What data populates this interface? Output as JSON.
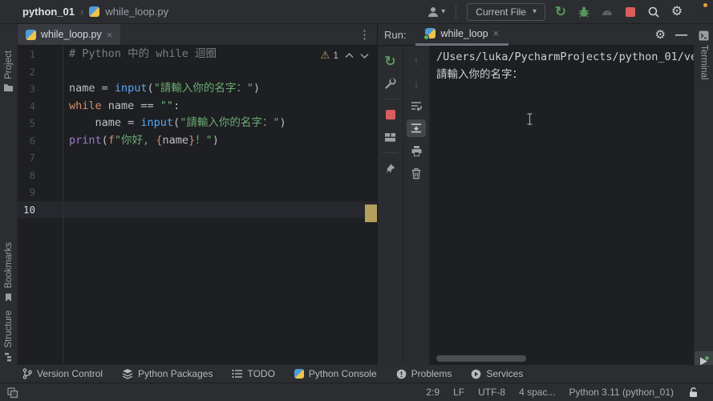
{
  "titlebar": {
    "project": "python_01",
    "separator": "›",
    "file": "while_loop.py",
    "run_config": "Current File"
  },
  "editor": {
    "tab": {
      "label": "while_loop.py",
      "close": "×"
    },
    "warning_count": "1",
    "current_line": "10",
    "lines": [
      {
        "n": "1",
        "seg": [
          [
            "cm",
            "# Python 中的 while 迴圈"
          ]
        ]
      },
      {
        "n": "2",
        "seg": []
      },
      {
        "n": "3",
        "seg": [
          [
            "tx",
            "name = "
          ],
          [
            "fn",
            "input"
          ],
          [
            "tx",
            "("
          ],
          [
            "st",
            "\"請輸入你的名字："
          ],
          [
            "st",
            "\""
          ],
          [
            "tx",
            ")"
          ]
        ]
      },
      {
        "n": "4",
        "seg": [
          [
            "kw",
            "while"
          ],
          [
            "tx",
            " name == "
          ],
          [
            "st",
            "\"\""
          ],
          [
            "tx",
            ":"
          ]
        ]
      },
      {
        "n": "5",
        "seg": [
          [
            "tx",
            "    name = "
          ],
          [
            "fn",
            "input"
          ],
          [
            "tx",
            "("
          ],
          [
            "st",
            "\"請輸入你的名字："
          ],
          [
            "st",
            "\""
          ],
          [
            "tx",
            ")"
          ]
        ]
      },
      {
        "n": "6",
        "seg": [
          [
            "bi",
            "print"
          ],
          [
            "tx",
            "("
          ],
          [
            "kw",
            "f"
          ],
          [
            "st",
            "\"你好, "
          ],
          [
            "kw",
            "{"
          ],
          [
            "tx",
            "name"
          ],
          [
            "kw",
            "}"
          ],
          [
            "st",
            "！\""
          ],
          [
            "tx",
            ")"
          ]
        ]
      },
      {
        "n": "7",
        "seg": []
      },
      {
        "n": "8",
        "seg": []
      },
      {
        "n": "9",
        "seg": []
      },
      {
        "n": "10",
        "seg": []
      }
    ]
  },
  "run": {
    "label": "Run:",
    "tab": {
      "label": "while_loop",
      "close": "×"
    },
    "console_lines": [
      "/Users/luka/PycharmProjects/python_01/ve",
      "請輸入你的名字："
    ]
  },
  "stripes": {
    "left": [
      {
        "label": "Project",
        "icon": "folder-icon"
      },
      {
        "label": "Bookmarks",
        "icon": "bookmark-icon"
      },
      {
        "label": "Structure",
        "icon": "structure-icon"
      }
    ],
    "right_top": {
      "label": "Terminal",
      "icon": "terminal-icon"
    },
    "right_bottom": {
      "label": "Run",
      "icon": "run-play-icon"
    }
  },
  "bottombar": {
    "items": [
      {
        "label": "Version Control",
        "icon": "branch-icon"
      },
      {
        "label": "Python Packages",
        "icon": "packages-icon"
      },
      {
        "label": "TODO",
        "icon": "todo-list-icon"
      },
      {
        "label": "Python Console",
        "icon": "python-icon"
      },
      {
        "label": "Problems",
        "icon": "problems-icon"
      },
      {
        "label": "Services",
        "icon": "services-icon"
      }
    ]
  },
  "statusbar": {
    "caret": "2:9",
    "line_ending": "LF",
    "encoding": "UTF-8",
    "indent": "4 spac...",
    "interpreter": "Python 3.11 (python_01)"
  },
  "colors": {
    "keyword": "#CF8E6D",
    "string": "#6AAB73",
    "function_call": "#56A8F5",
    "builtin": "#9B7CC8",
    "comment": "#7A7E85",
    "text": "#BCBEC4",
    "accent_green": "#57965C",
    "stop_red": "#DB5C5C",
    "warning_tan": "#C8A361",
    "editor_bg": "#1E1F22",
    "panel_bg": "#2B2D30"
  }
}
